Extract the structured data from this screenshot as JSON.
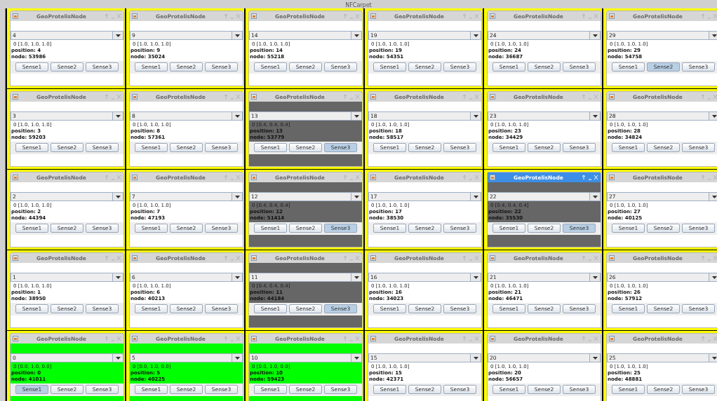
{
  "desktop_title": "NFCarpet",
  "windows": [
    {
      "title": "GeoProtelisNode",
      "active": false,
      "color": "#ffffff",
      "combo": "4",
      "color_line": "0 [1.0, 1.0, 1.0]",
      "position": "position: 4",
      "node": "node: 53986",
      "buttons": [
        {
          "label": "Sense1",
          "selected": false
        },
        {
          "label": "Sense2",
          "selected": false
        },
        {
          "label": "Sense3",
          "selected": false
        }
      ]
    },
    {
      "title": "GeoProtelisNode",
      "active": false,
      "color": "#ffffff",
      "combo": "9",
      "color_line": "0 [1.0, 1.0, 1.0]",
      "position": "position: 9",
      "node": "node: 35024",
      "buttons": [
        {
          "label": "Sense1",
          "selected": false
        },
        {
          "label": "Sense2",
          "selected": false
        },
        {
          "label": "Sense3",
          "selected": false
        }
      ]
    },
    {
      "title": "GeoProtelisNode",
      "active": false,
      "color": "#ffffff",
      "combo": "14",
      "color_line": "0 [1.0, 1.0, 1.0]",
      "position": "position: 14",
      "node": "node: 55218",
      "buttons": [
        {
          "label": "Sense1",
          "selected": false
        },
        {
          "label": "Sense2",
          "selected": false
        },
        {
          "label": "Sense3",
          "selected": false
        }
      ]
    },
    {
      "title": "GeoProtelisNode",
      "active": false,
      "color": "#ffffff",
      "combo": "19",
      "color_line": "0 [1.0, 1.0, 1.0]",
      "position": "position: 19",
      "node": "node: 54351",
      "buttons": [
        {
          "label": "Sense1",
          "selected": false
        },
        {
          "label": "Sense2",
          "selected": false
        },
        {
          "label": "Sense3",
          "selected": false
        }
      ]
    },
    {
      "title": "GeoProtelisNode",
      "active": false,
      "color": "#ffffff",
      "combo": "24",
      "color_line": "0 [1.0, 1.0, 1.0]",
      "position": "position: 24",
      "node": "node: 36687",
      "buttons": [
        {
          "label": "Sense1",
          "selected": false
        },
        {
          "label": "Sense2",
          "selected": false
        },
        {
          "label": "Sense3",
          "selected": false
        }
      ]
    },
    {
      "title": "GeoProtelisNode",
      "active": false,
      "color": "#ffffff",
      "combo": "29",
      "color_line": "0 [1.0, 1.0, 1.0]",
      "position": "position: 29",
      "node": "node: 54758",
      "buttons": [
        {
          "label": "Sense1",
          "selected": false
        },
        {
          "label": "Sense2",
          "selected": true
        },
        {
          "label": "Sense3",
          "selected": false
        }
      ]
    },
    {
      "title": "GeoProtelisNode",
      "active": false,
      "color": "#ffffff",
      "combo": "3",
      "color_line": "0 [1.0, 1.0, 1.0]",
      "position": "position: 3",
      "node": "node: 59203",
      "buttons": [
        {
          "label": "Sense1",
          "selected": false
        },
        {
          "label": "Sense2",
          "selected": false
        },
        {
          "label": "Sense3",
          "selected": false
        }
      ]
    },
    {
      "title": "GeoProtelisNode",
      "active": false,
      "color": "#ffffff",
      "combo": "8",
      "color_line": "0 [1.0, 1.0, 1.0]",
      "position": "position: 8",
      "node": "node: 57361",
      "buttons": [
        {
          "label": "Sense1",
          "selected": false
        },
        {
          "label": "Sense2",
          "selected": false
        },
        {
          "label": "Sense3",
          "selected": false
        }
      ]
    },
    {
      "title": "GeoProtelisNode",
      "active": false,
      "color": "#666666",
      "combo": "13",
      "color_line": "0 [0.4, 0.4, 0.4]",
      "position": "position: 13",
      "node": "node: 53779",
      "buttons": [
        {
          "label": "Sense1",
          "selected": false
        },
        {
          "label": "Sense2",
          "selected": false
        },
        {
          "label": "Sense3",
          "selected": true
        }
      ]
    },
    {
      "title": "GeoProtelisNode",
      "active": false,
      "color": "#ffffff",
      "combo": "18",
      "color_line": "0 [1.0, 1.0, 1.0]",
      "position": "position: 18",
      "node": "node: 58517",
      "buttons": [
        {
          "label": "Sense1",
          "selected": false
        },
        {
          "label": "Sense2",
          "selected": false
        },
        {
          "label": "Sense3",
          "selected": false
        }
      ]
    },
    {
      "title": "GeoProtelisNode",
      "active": false,
      "color": "#ffffff",
      "combo": "23",
      "color_line": "0 [1.0, 1.0, 1.0]",
      "position": "position: 23",
      "node": "node: 34429",
      "buttons": [
        {
          "label": "Sense1",
          "selected": false
        },
        {
          "label": "Sense2",
          "selected": false
        },
        {
          "label": "Sense3",
          "selected": false
        }
      ]
    },
    {
      "title": "GeoProtelisNode",
      "active": false,
      "color": "#ffffff",
      "combo": "28",
      "color_line": "0 [1.0, 1.0, 1.0]",
      "position": "position: 28",
      "node": "node: 34824",
      "buttons": [
        {
          "label": "Sense1",
          "selected": false
        },
        {
          "label": "Sense2",
          "selected": false
        },
        {
          "label": "Sense3",
          "selected": false
        }
      ]
    },
    {
      "title": "GeoProtelisNode",
      "active": false,
      "color": "#ffffff",
      "combo": "2",
      "color_line": "0 [1.0, 1.0, 1.0]",
      "position": "position: 2",
      "node": "node: 44394",
      "buttons": [
        {
          "label": "Sense1",
          "selected": false
        },
        {
          "label": "Sense2",
          "selected": false
        },
        {
          "label": "Sense3",
          "selected": false
        }
      ]
    },
    {
      "title": "GeoProtelisNode",
      "active": false,
      "color": "#ffffff",
      "combo": "7",
      "color_line": "0 [1.0, 1.0, 1.0]",
      "position": "position: 7",
      "node": "node: 47193",
      "buttons": [
        {
          "label": "Sense1",
          "selected": false
        },
        {
          "label": "Sense2",
          "selected": false
        },
        {
          "label": "Sense3",
          "selected": false
        }
      ]
    },
    {
      "title": "GeoProtelisNode",
      "active": false,
      "color": "#666666",
      "combo": "12",
      "color_line": "0 [0.4, 0.4, 0.4]",
      "position": "position: 12",
      "node": "node: 51414",
      "buttons": [
        {
          "label": "Sense1",
          "selected": false
        },
        {
          "label": "Sense2",
          "selected": false
        },
        {
          "label": "Sense3",
          "selected": true
        }
      ]
    },
    {
      "title": "GeoProtelisNode",
      "active": false,
      "color": "#ffffff",
      "combo": "17",
      "color_line": "0 [1.0, 1.0, 1.0]",
      "position": "position: 17",
      "node": "node: 38530",
      "buttons": [
        {
          "label": "Sense1",
          "selected": false
        },
        {
          "label": "Sense2",
          "selected": false
        },
        {
          "label": "Sense3",
          "selected": false
        }
      ]
    },
    {
      "title": "GeoProtelisNode",
      "active": true,
      "color": "#666666",
      "combo": "22",
      "color_line": "0 [0.4, 0.4, 0.4]",
      "position": "position: 22",
      "node": "node: 35530",
      "buttons": [
        {
          "label": "Sense1",
          "selected": false
        },
        {
          "label": "Sense2",
          "selected": false
        },
        {
          "label": "Sense3",
          "selected": true
        }
      ]
    },
    {
      "title": "GeoProtelisNode",
      "active": false,
      "color": "#ffffff",
      "combo": "27",
      "color_line": "0 [1.0, 1.0, 1.0]",
      "position": "position: 27",
      "node": "node: 40125",
      "buttons": [
        {
          "label": "Sense1",
          "selected": false
        },
        {
          "label": "Sense2",
          "selected": false
        },
        {
          "label": "Sense3",
          "selected": false
        }
      ]
    },
    {
      "title": "GeoProtelisNode",
      "active": false,
      "color": "#ffffff",
      "combo": "1",
      "color_line": "0 [1.0, 1.0, 1.0]",
      "position": "position: 1",
      "node": "node: 38950",
      "buttons": [
        {
          "label": "Sense1",
          "selected": false
        },
        {
          "label": "Sense2",
          "selected": false
        },
        {
          "label": "Sense3",
          "selected": false
        }
      ]
    },
    {
      "title": "GeoProtelisNode",
      "active": false,
      "color": "#ffffff",
      "combo": "6",
      "color_line": "0 [1.0, 1.0, 1.0]",
      "position": "position: 6",
      "node": "node: 40213",
      "buttons": [
        {
          "label": "Sense1",
          "selected": false
        },
        {
          "label": "Sense2",
          "selected": false
        },
        {
          "label": "Sense3",
          "selected": false
        }
      ]
    },
    {
      "title": "GeoProtelisNode",
      "active": false,
      "color": "#666666",
      "combo": "11",
      "color_line": "0 [0.4, 0.4, 0.4]",
      "position": "position: 11",
      "node": "node: 44184",
      "buttons": [
        {
          "label": "Sense1",
          "selected": false
        },
        {
          "label": "Sense2",
          "selected": false
        },
        {
          "label": "Sense3",
          "selected": true
        }
      ]
    },
    {
      "title": "GeoProtelisNode",
      "active": false,
      "color": "#ffffff",
      "combo": "16",
      "color_line": "0 [1.0, 1.0, 1.0]",
      "position": "position: 16",
      "node": "node: 34023",
      "buttons": [
        {
          "label": "Sense1",
          "selected": false
        },
        {
          "label": "Sense2",
          "selected": false
        },
        {
          "label": "Sense3",
          "selected": false
        }
      ]
    },
    {
      "title": "GeoProtelisNode",
      "active": false,
      "color": "#ffffff",
      "combo": "21",
      "color_line": "0 [1.0, 1.0, 1.0]",
      "position": "position: 21",
      "node": "node: 46471",
      "buttons": [
        {
          "label": "Sense1",
          "selected": false
        },
        {
          "label": "Sense2",
          "selected": false
        },
        {
          "label": "Sense3",
          "selected": false
        }
      ]
    },
    {
      "title": "GeoProtelisNode",
      "active": false,
      "color": "#ffffff",
      "combo": "26",
      "color_line": "0 [1.0, 1.0, 1.0]",
      "position": "position: 26",
      "node": "node: 57912",
      "buttons": [
        {
          "label": "Sense1",
          "selected": false
        },
        {
          "label": "Sense2",
          "selected": false
        },
        {
          "label": "Sense3",
          "selected": false
        }
      ]
    },
    {
      "title": "GeoProtelisNode",
      "active": false,
      "color": "#00ff00",
      "combo": "0",
      "color_line": "0 [0.0, 1.0, 0.0]",
      "position": "position: 0",
      "node": "node: 41011",
      "buttons": [
        {
          "label": "Sense1",
          "selected": true
        },
        {
          "label": "Sense2",
          "selected": false
        },
        {
          "label": "Sense3",
          "selected": false
        }
      ]
    },
    {
      "title": "GeoProtelisNode",
      "active": false,
      "color": "#00ff00",
      "combo": "5",
      "color_line": "0 [0.0, 1.0, 0.0]",
      "position": "position: 5",
      "node": "node: 40225",
      "buttons": [
        {
          "label": "Sense1",
          "selected": false
        },
        {
          "label": "Sense2",
          "selected": false
        },
        {
          "label": "Sense3",
          "selected": false
        }
      ]
    },
    {
      "title": "GeoProtelisNode",
      "active": false,
      "color": "#00ff00",
      "combo": "10",
      "color_line": "0 [0.0, 1.0, 0.0]",
      "position": "position: 10",
      "node": "node: 59423",
      "buttons": [
        {
          "label": "Sense1",
          "selected": false
        },
        {
          "label": "Sense2",
          "selected": false
        },
        {
          "label": "Sense3",
          "selected": false
        }
      ]
    },
    {
      "title": "GeoProtelisNode",
      "active": false,
      "color": "#ffffff",
      "combo": "15",
      "color_line": "0 [1.0, 1.0, 1.0]",
      "position": "position: 15",
      "node": "node: 42371",
      "buttons": [
        {
          "label": "Sense1",
          "selected": false
        },
        {
          "label": "Sense2",
          "selected": false
        },
        {
          "label": "Sense3",
          "selected": false
        }
      ]
    },
    {
      "title": "GeoProtelisNode",
      "active": false,
      "color": "#ffffff",
      "combo": "20",
      "color_line": "0 [1.0, 1.0, 1.0]",
      "position": "position: 20",
      "node": "node: 56657",
      "buttons": [
        {
          "label": "Sense1",
          "selected": false
        },
        {
          "label": "Sense2",
          "selected": false
        },
        {
          "label": "Sense3",
          "selected": false
        }
      ]
    },
    {
      "title": "GeoProtelisNode",
      "active": false,
      "color": "#ffffff",
      "combo": "25",
      "color_line": "0 [1.0, 1.0, 1.0]",
      "position": "position: 25",
      "node": "node: 48881",
      "buttons": [
        {
          "label": "Sense1",
          "selected": false
        },
        {
          "label": "Sense2",
          "selected": false
        },
        {
          "label": "Sense3",
          "selected": false
        }
      ]
    }
  ]
}
